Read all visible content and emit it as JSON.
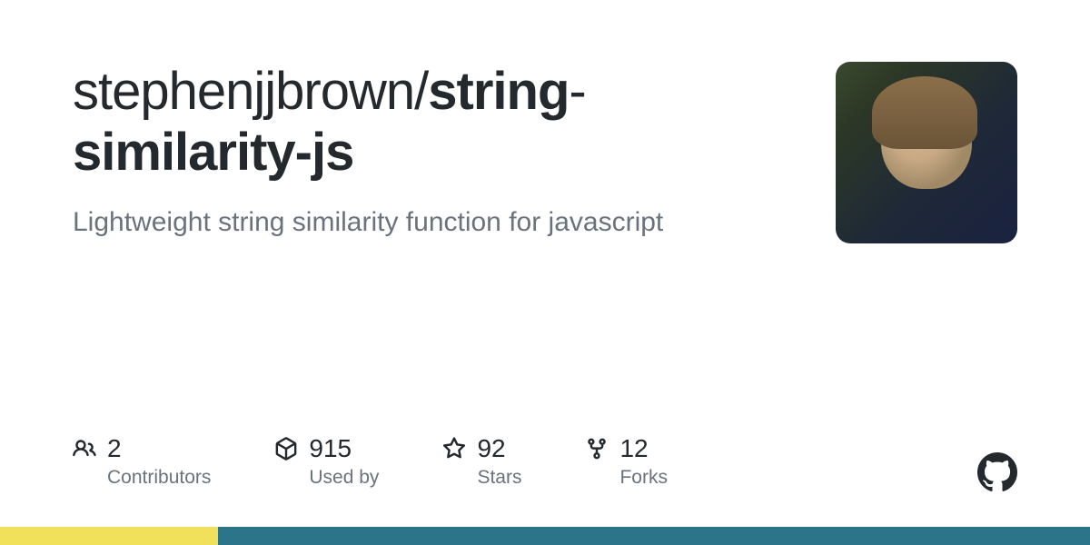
{
  "repo": {
    "owner": "stephenjjbrown",
    "separator": "/",
    "name_part1": "string",
    "name_part2": "similarity-js",
    "description": "Lightweight string similarity function for javascript"
  },
  "stats": {
    "contributors": {
      "value": "2",
      "label": "Contributors"
    },
    "used_by": {
      "value": "915",
      "label": "Used by"
    },
    "stars": {
      "value": "92",
      "label": "Stars"
    },
    "forks": {
      "value": "12",
      "label": "Forks"
    }
  },
  "language_bar": [
    {
      "color": "#f1e05a",
      "percent": 20
    },
    {
      "color": "#2b7489",
      "percent": 80
    }
  ]
}
